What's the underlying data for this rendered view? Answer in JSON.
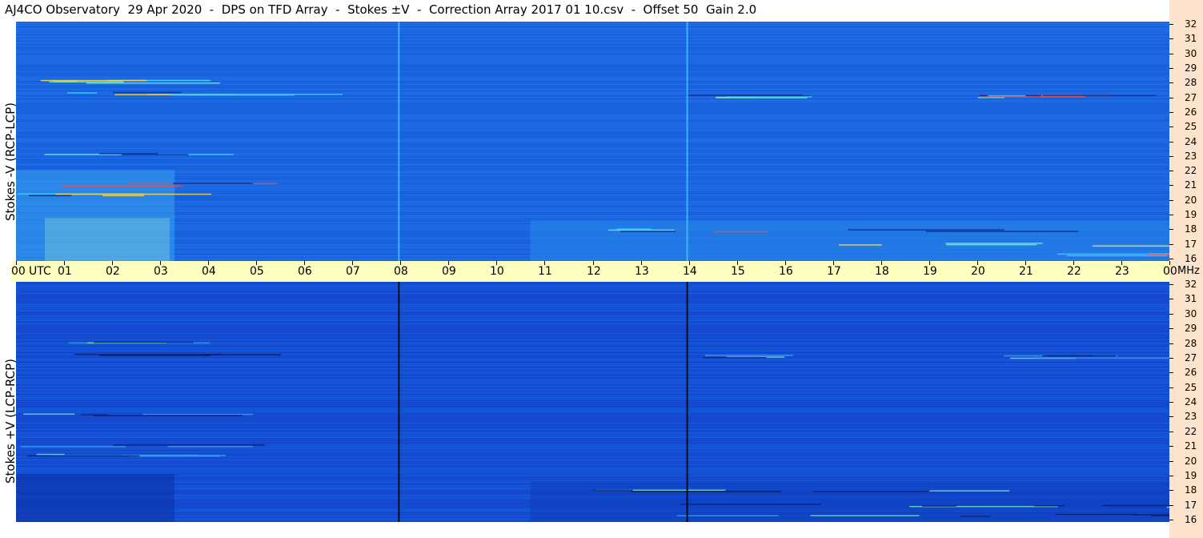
{
  "title": "AJ4CO Observatory  29 Apr 2020  -  DPS on TFD Array  -  Stokes ±V  -  Correction Array 2017 01 10.csv  -  Offset 50  Gain 2.0",
  "panels": [
    {
      "label": "Stokes -V (RCP-LCP)"
    },
    {
      "label": "Stokes +V (LCP-RCP)"
    }
  ],
  "time_axis": {
    "unit_label": "UTC",
    "labels": [
      "00",
      "01",
      "02",
      "03",
      "04",
      "05",
      "06",
      "07",
      "08",
      "09",
      "10",
      "11",
      "12",
      "13",
      "14",
      "15",
      "16",
      "17",
      "18",
      "19",
      "20",
      "21",
      "22",
      "23",
      "00"
    ]
  },
  "freq_axis": {
    "unit_label": "MHz",
    "labels": [
      "32",
      "31",
      "30",
      "29",
      "28",
      "27",
      "26",
      "25",
      "24",
      "23",
      "22",
      "21",
      "20",
      "19",
      "18",
      "17",
      "16"
    ]
  },
  "colors": {
    "background_rcp": "#1a66e0",
    "background_lcp": "#144fd2",
    "timebar": "#ffffc0",
    "right_strip": "#fde3cc"
  },
  "chart_data": [
    {
      "type": "heatmap",
      "title": "",
      "ylabel": "Stokes -V (RCP-LCP)",
      "xlabel": "UTC",
      "xlim": [
        0,
        24
      ],
      "ylim": [
        16,
        32
      ],
      "x_ticks": [
        "00",
        "01",
        "02",
        "03",
        "04",
        "05",
        "06",
        "07",
        "08",
        "09",
        "10",
        "11",
        "12",
        "13",
        "14",
        "15",
        "16",
        "17",
        "18",
        "19",
        "20",
        "21",
        "22",
        "23",
        "00"
      ],
      "y_ticks": [
        32,
        31,
        30,
        29,
        28,
        27,
        26,
        25,
        24,
        23,
        22,
        21,
        20,
        19,
        18,
        17,
        16
      ]
    },
    {
      "type": "heatmap",
      "title": "",
      "ylabel": "Stokes +V (LCP-RCP)",
      "xlabel": "UTC",
      "xlim": [
        0,
        24
      ],
      "ylim": [
        16,
        32
      ],
      "x_ticks": [
        "00",
        "01",
        "02",
        "03",
        "04",
        "05",
        "06",
        "07",
        "08",
        "09",
        "10",
        "11",
        "12",
        "13",
        "14",
        "15",
        "16",
        "17",
        "18",
        "19",
        "20",
        "21",
        "22",
        "23",
        "00"
      ],
      "y_ticks": [
        32,
        31,
        30,
        29,
        28,
        27,
        26,
        25,
        24,
        23,
        22,
        21,
        20,
        19,
        18,
        17,
        16
      ]
    }
  ]
}
